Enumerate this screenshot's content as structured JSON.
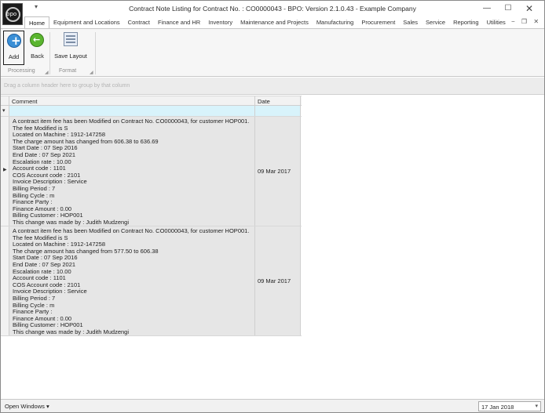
{
  "window": {
    "title": "Contract Note Listing for Contract No. : CO0000043 - BPO: Version 2.1.0.43 - Example Company",
    "logo_text": "bpo",
    "qat_icon": "chevron-down-icon",
    "minimize": "—",
    "maximize": "☐",
    "close": "✕"
  },
  "ribbon": {
    "tabs": [
      {
        "label": "Home",
        "active": true
      },
      {
        "label": "Equipment and Locations"
      },
      {
        "label": "Contract"
      },
      {
        "label": "Finance and HR"
      },
      {
        "label": "Inventory"
      },
      {
        "label": "Maintenance and Projects"
      },
      {
        "label": "Manufacturing"
      },
      {
        "label": "Procurement"
      },
      {
        "label": "Sales"
      },
      {
        "label": "Service"
      },
      {
        "label": "Reporting"
      },
      {
        "label": "Utilities"
      }
    ],
    "controls": {
      "collapse": "−",
      "restore": "❐",
      "close": "✕"
    },
    "buttons": {
      "add": "Add",
      "back": "Back",
      "save_layout": "Save Layout"
    },
    "groups": {
      "processing": "Processing",
      "format": "Format"
    }
  },
  "group_panel": {
    "hint": "Drag a column header here to group by that column"
  },
  "grid": {
    "columns": [
      "Comment",
      "Date"
    ],
    "filter_icon": "▾",
    "rows": [
      {
        "comment_lines": [
          "A contract item fee has been Modified on Contract No. CO0000043, for customer HOP001.",
          "The fee Modified is S",
          "Located on Machine : 1912-147258",
          "The charge amount has changed from 606.38 to 636.69",
          "Start Date : 07 Sep 2016",
          "End Date : 07 Sep 2021",
          "Escalation rate : 10.00",
          "Account code : 1101",
          "COS Account code : 2101",
          "Invoice Description : Service",
          "Billing Period : 7",
          "Billing Cycle : m",
          "Finance Party :",
          "Finance Amount : 0.00",
          "Billing Customer : HOP001",
          "This change was made by : Judith Mudzengi"
        ],
        "date": "09 Mar 2017",
        "current": true
      },
      {
        "comment_lines": [
          "A contract item fee has been Modified on Contract No. CO0000043, for customer HOP001.",
          "The fee Modified is S",
          "Located on Machine : 1912-147258",
          "The charge amount has changed from 577.50 to 606.38",
          "Start Date : 07 Sep 2016",
          "End Date : 07 Sep 2021",
          "Escalation rate : 10.00",
          "Account code : 1101",
          "COS Account code : 2101",
          "Invoice Description : Service",
          "Billing Period : 7",
          "Billing Cycle : m",
          "Finance Party :",
          "Finance Amount : 0.00",
          "Billing Customer : HOP001",
          "This change was made by : Judith Mudzengi"
        ],
        "date": "09 Mar 2017",
        "current": false
      }
    ]
  },
  "statusbar": {
    "open_windows": "Open Windows ▾",
    "date": "17 Jan 2018",
    "date_dropdown": "▾"
  }
}
